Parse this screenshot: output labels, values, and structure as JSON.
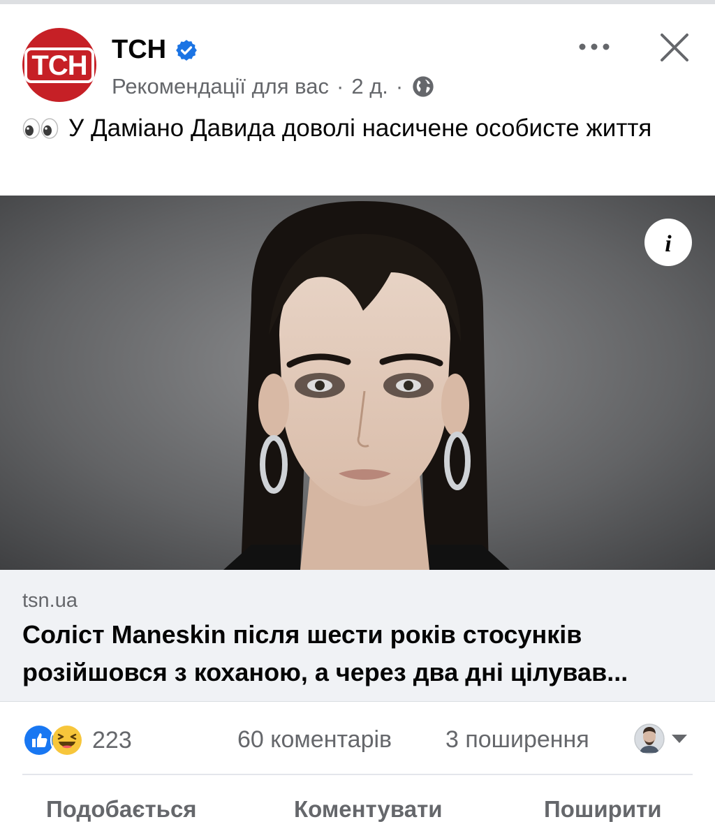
{
  "post": {
    "page_name": "ТСН",
    "avatar_logo_text": "ТСН",
    "verified_icon": "verified-badge-icon",
    "meta": {
      "label": "Рекомендації для вас",
      "separator": "·",
      "time": "2 д.",
      "audience_icon": "globe-icon"
    },
    "emoji": "👀",
    "text": "У Даміано Давида доволі насичене особисте життя"
  },
  "link_preview": {
    "domain": "tsn.ua",
    "headline": "Соліст Maneskin після шести років стосунків\nрозійшовся з коханою, а через два дні цілував..."
  },
  "stats": {
    "reactions_count": "223",
    "comments": "60 коментарів",
    "shares": "3 поширення"
  },
  "actions": {
    "like": "Подобається",
    "comment": "Коментувати",
    "share": "Поширити"
  },
  "colors": {
    "brand_red": "#c62026",
    "verified_blue": "#1b74e4",
    "secondary_text": "#65676b",
    "link_bg": "#f0f2f5"
  }
}
